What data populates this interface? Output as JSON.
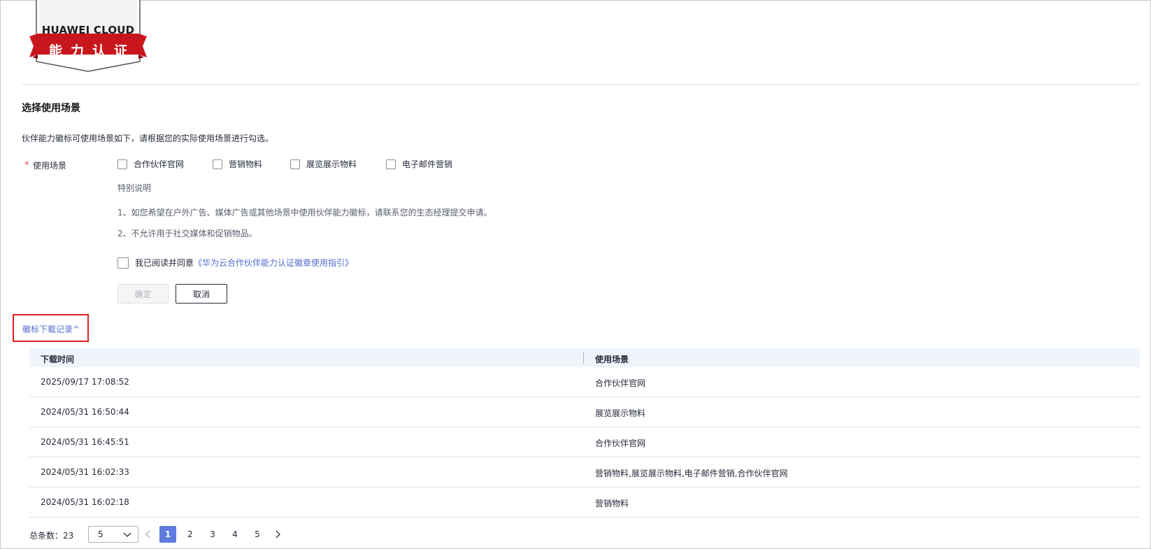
{
  "logo": {
    "brand_en": "HUAWEI CLOUD",
    "brand_cn": "能力认证"
  },
  "section": {
    "title": "选择使用场景",
    "intro": "伙伴能力徽标可使用场景如下，请根据您的实际使用场景进行勾选。"
  },
  "form": {
    "required_mark": "*",
    "field_label": "使用场景",
    "options": [
      "合作伙伴官网",
      "营销物料",
      "展览展示物料",
      "电子邮件营销"
    ],
    "note_title": "特别说明",
    "notes": [
      "1、如您希望在户外广告、媒体广告或其他场景中使用伙伴能力徽标，请联系您的生态经理提交申请。",
      "2、不允许用于社交媒体和促销物品。"
    ],
    "agree_text": "我已阅读并同意",
    "agree_link": "《华为云合作伙伴能力认证徽章使用指引》",
    "confirm_label": "确定",
    "cancel_label": "取消"
  },
  "records": {
    "toggle_label": "徽标下载记录^",
    "columns": [
      "下载时间",
      "使用场景"
    ],
    "rows": [
      {
        "time": "2025/09/17 17:08:52",
        "scene": "合作伙伴官网"
      },
      {
        "time": "2024/05/31 16:50:44",
        "scene": "展览展示物料"
      },
      {
        "time": "2024/05/31 16:45:51",
        "scene": "合作伙伴官网"
      },
      {
        "time": "2024/05/31 16:02:33",
        "scene": "营销物料,展览展示物料,电子邮件营销,合作伙伴官网"
      },
      {
        "time": "2024/05/31 16:02:18",
        "scene": "营销物料"
      }
    ]
  },
  "pagination": {
    "total_label": "总条数：23",
    "page_size": "5",
    "pages": [
      "1",
      "2",
      "3",
      "4",
      "5"
    ],
    "current_page": "1"
  },
  "colors": {
    "link": "#526ecc",
    "active_page": "#5e7ce0",
    "highlight_border": "#e02020",
    "logo_red": "#c8161d"
  }
}
